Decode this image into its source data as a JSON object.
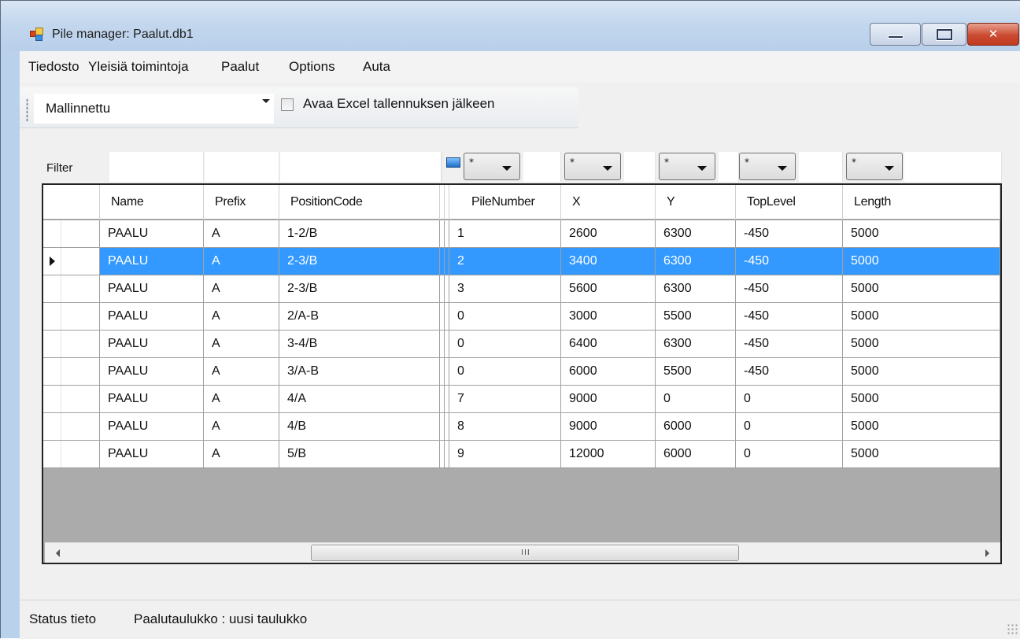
{
  "window": {
    "title": "Pile manager: Paalut.db1",
    "min_glyph": "",
    "max_glyph": "",
    "close_glyph": "✕"
  },
  "menu": {
    "items": [
      "Tiedosto",
      "Yleisiä toimintoja",
      "Paalut",
      "Options",
      "Auta"
    ]
  },
  "toolbar": {
    "view_select": "Mallinnettu",
    "open_excel_label": "Avaa Excel tallennuksen jälkeen",
    "open_excel_checked": false
  },
  "filter": {
    "label": "Filter",
    "dropdown_value": "*"
  },
  "table": {
    "columns": [
      "Name",
      "Prefix",
      "PositionCode",
      "PileNumber",
      "X",
      "Y",
      "TopLevel",
      "Length"
    ],
    "selected_row": 1,
    "rows": [
      [
        "PAALU",
        "A",
        "1-2/B",
        "1",
        "2600",
        "6300",
        "-450",
        "5000"
      ],
      [
        "PAALU",
        "A",
        "2-3/B",
        "2",
        "3400",
        "6300",
        "-450",
        "5000"
      ],
      [
        "PAALU",
        "A",
        "2-3/B",
        "3",
        "5600",
        "6300",
        "-450",
        "5000"
      ],
      [
        "PAALU",
        "A",
        "2/A-B",
        "0",
        "3000",
        "5500",
        "-450",
        "5000"
      ],
      [
        "PAALU",
        "A",
        "3-4/B",
        "0",
        "6400",
        "6300",
        "-450",
        "5000"
      ],
      [
        "PAALU",
        "A",
        "3/A-B",
        "0",
        "6000",
        "5500",
        "-450",
        "5000"
      ],
      [
        "PAALU",
        "A",
        "4/A",
        "7",
        "9000",
        "0",
        "0",
        "5000"
      ],
      [
        "PAALU",
        "A",
        "4/B",
        "8",
        "9000",
        "6000",
        "0",
        "5000"
      ],
      [
        "PAALU",
        "A",
        "5/B",
        "9",
        "12000",
        "6000",
        "0",
        "5000"
      ]
    ],
    "scrollbar_grip": "III"
  },
  "status": {
    "label": "Status tieto",
    "message": "Paalutaulukko : uusi taulukko"
  }
}
